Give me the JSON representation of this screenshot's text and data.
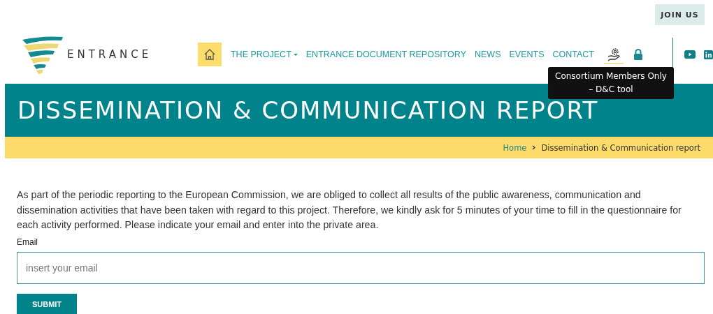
{
  "top_bar": {
    "join_button": "JOIN US"
  },
  "header": {
    "logo_text": "ENTRANCE",
    "nav": [
      {
        "label": "THE PROJECT",
        "dropdown": true
      },
      {
        "label": "ENTRANCE DOCUMENT REPOSITORY",
        "dropdown": false
      },
      {
        "label": "NEWS",
        "dropdown": false
      },
      {
        "label": "EVENTS",
        "dropdown": false
      },
      {
        "label": "CONTACT",
        "dropdown": false
      }
    ],
    "tool_hovered": true,
    "tooltip": [
      "Consortium Members Only",
      "– D&C tool"
    ]
  },
  "banner": {
    "title": "DISSEMINATION & COMMUNICATION REPORT"
  },
  "breadcrumb": [
    {
      "label": "Home",
      "kind": "link"
    },
    {
      "label": "Dissemination & Communication report",
      "kind": "current"
    }
  ],
  "intro": "As part of the periodic reporting to the European Commission, we are obliged to collect all results of the public awareness, communication and dissemination activities that have been taken with regard to this project. Therefore, we kindly ask for 5 minutes of your time to fill in the questionnaire for each activity performed. Please indicate your email and enter into the private area.",
  "form": {
    "label": "Email",
    "placeholder": "insert your email",
    "submit": "SUBMIT"
  }
}
